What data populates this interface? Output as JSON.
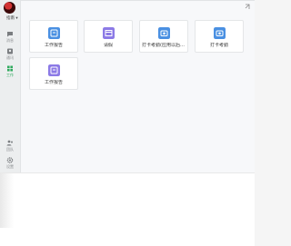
{
  "sidebar": {
    "avatar_label": "",
    "items": [
      {
        "label": "消息",
        "icon": "chat-icon",
        "active": false
      },
      {
        "label": "通讯",
        "icon": "contacts-icon",
        "active": false
      },
      {
        "label": "工作",
        "icon": "workbench-icon",
        "active": true
      },
      {
        "label": "团队",
        "icon": "team-icon",
        "active": false
      },
      {
        "label": "设置",
        "icon": "gear-icon",
        "active": false
      }
    ]
  },
  "header": {
    "org_label": "指南 ▾"
  },
  "tiles": [
    {
      "label": "工作报告",
      "color": "#4a90e2",
      "icon": "report-icon"
    },
    {
      "label": "请假",
      "color": "#8c7ae6",
      "icon": "calendar-icon"
    },
    {
      "label": "打卡考勤(应用以后信…",
      "color": "#4a90e2",
      "icon": "camera-icon"
    },
    {
      "label": "打卡考勤",
      "color": "#4a90e2",
      "icon": "camera-icon"
    },
    {
      "label": "工作报告",
      "color": "#8c7ae6",
      "icon": "report-icon"
    }
  ],
  "colors": {
    "accent": "#2faa5d",
    "tile_blue": "#4a90e2",
    "tile_purple": "#8c7ae6"
  }
}
